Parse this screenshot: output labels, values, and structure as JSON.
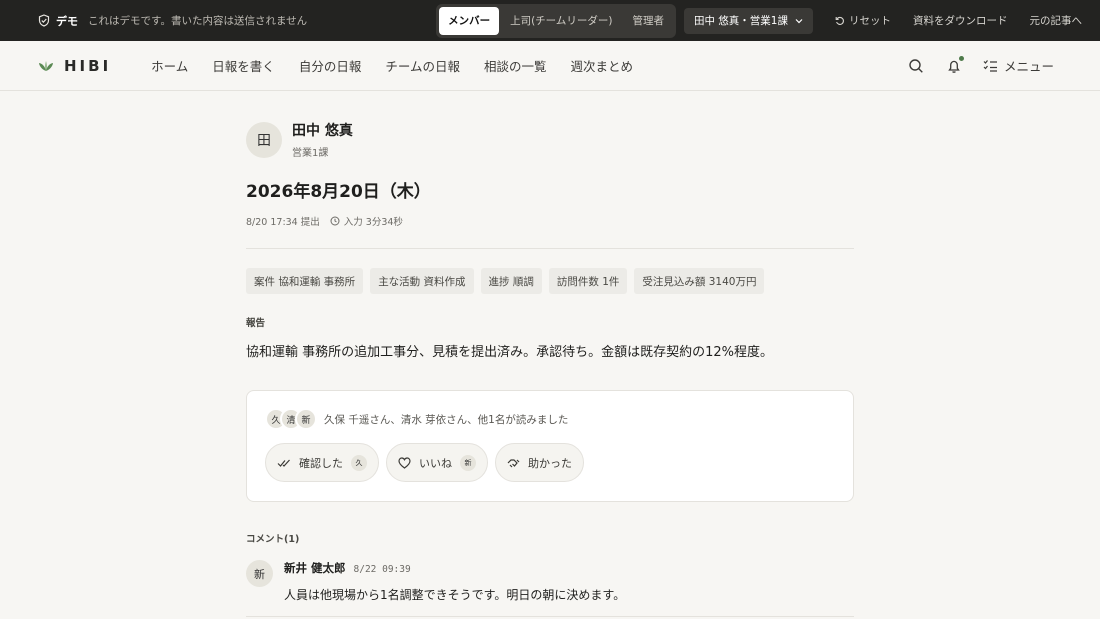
{
  "demo_bar": {
    "tag": "デモ",
    "note": "これはデモです。書いた内容は送信されません",
    "roles": [
      "メンバー",
      "上司(チームリーダー)",
      "管理者"
    ],
    "active_role": "メンバー",
    "user_select": "田中 悠真・営業1課",
    "reset": "リセット",
    "download": "資料をダウンロード",
    "original": "元の記事へ"
  },
  "nav": {
    "logo": "HIBI",
    "items": [
      "ホーム",
      "日報を書く",
      "自分の日報",
      "チームの日報",
      "相談の一覧",
      "週次まとめ"
    ],
    "menu": "メニュー"
  },
  "report": {
    "author_initial": "田",
    "author_name": "田中 悠真",
    "author_dept": "営業1課",
    "date": "2026年8月20日（木）",
    "submitted": "8/20 17:34 提出",
    "input_time": "入力 3分34秒",
    "chips": [
      "案件 協和運輸 事務所",
      "主な活動 資料作成",
      "進捗 順調",
      "訪問件数 1件",
      "受注見込み額 3140万円"
    ],
    "section_label": "報告",
    "body": "協和運輸 事務所の追加工事分、見積を提出済み。承認待ち。金額は既存契約の12%程度。"
  },
  "readers": {
    "initials": [
      "久",
      "清",
      "新"
    ],
    "text": "久保 千遥さん、清水 芽依さん、他1名が読みました"
  },
  "reactions": [
    {
      "label": "確認した",
      "who": "久"
    },
    {
      "label": "いいね",
      "who": "新"
    },
    {
      "label": "助かった",
      "who": ""
    }
  ],
  "comments": {
    "label": "コメント(1)",
    "items": [
      {
        "initial": "新",
        "name": "新井 健太郎",
        "time": "8/22 09:39",
        "text": "人員は他現場から1名調整できそうです。明日の朝に決めます。"
      }
    ]
  }
}
